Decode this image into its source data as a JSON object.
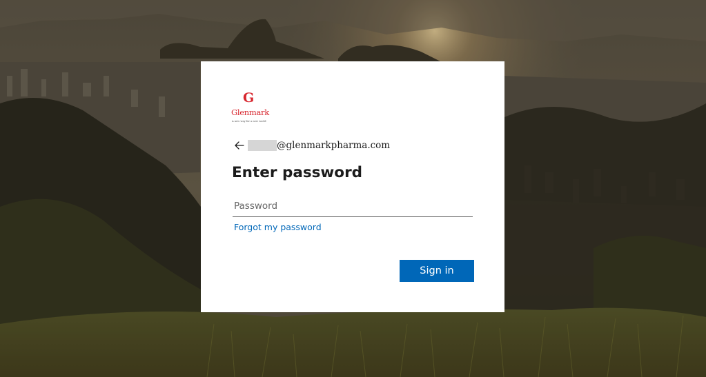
{
  "brand": {
    "logo_mark": "G",
    "logo_wordmark": "Glenmark",
    "logo_tagline": "A new way for a new world",
    "color": "#d7262e"
  },
  "identity": {
    "back_icon": "arrow-left-icon",
    "email_domain": "@glenmarkpharma.com"
  },
  "form": {
    "title": "Enter password",
    "password_placeholder": "Password",
    "password_value": "",
    "forgot_link": "Forgot my password",
    "signin_label": "Sign in"
  },
  "colors": {
    "accent": "#0067b8",
    "card_bg": "#ffffff",
    "text": "#1b1b1b"
  }
}
